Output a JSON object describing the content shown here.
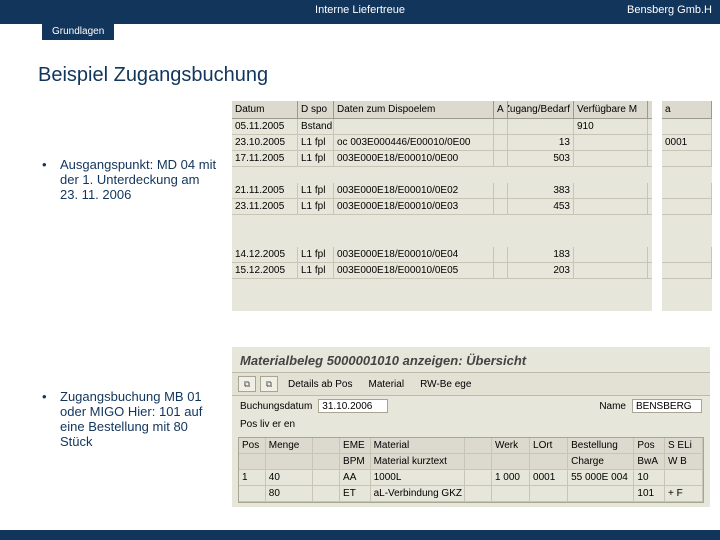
{
  "header": {
    "title_center": "Interne Liefertreue",
    "title_right": "Bensberg Gmb.H",
    "tab": "Grundlagen"
  },
  "heading": "Beispiel Zugangsbuchung",
  "bullets": {
    "b1": "Ausgangspunkt: MD 04 mit der 1. Unterdeckung am 23. 11. 2006",
    "b2": "Zugangsbuchung MB 01 oder MIGO Hier: 101 auf eine Bestellung mit 80 Stück"
  },
  "md04": {
    "headers": {
      "datum": "Datum",
      "dispo": "D spo",
      "elem": "Daten zum Dispoelem",
      "a": "A",
      "zugang": "Zugang/Bedarf",
      "verf": "Verfügbare M"
    },
    "right_header": "a",
    "rows": [
      {
        "datum": "05.11.2005",
        "dispo": "Bstand",
        "elem": "",
        "a": "",
        "zugang": "",
        "verf": "910",
        "right": ""
      },
      {
        "datum": "23.10.2005",
        "dispo": "L1 fpl",
        "elem": "oc 003E000446/E00010/0E00",
        "a": "",
        "zugang": "13",
        "verf": "",
        "right": "0001"
      },
      {
        "datum": "17.11.2005",
        "dispo": "L1 fpl",
        "elem": "003E000E18/E00010/0E00",
        "a": "",
        "zugang": "503",
        "verf": "",
        "right": ""
      },
      {
        "gap": true
      },
      {
        "datum": "21.11.2005",
        "dispo": "L1 fpl",
        "elem": "003E000E18/E00010/0E02",
        "a": "",
        "zugang": "383",
        "verf": "",
        "right": ""
      },
      {
        "datum": "23.11.2005",
        "dispo": "L1 fpl",
        "elem": "003E000E18/E00010/0E03",
        "a": "",
        "zugang": "453",
        "verf": "",
        "right": ""
      },
      {
        "gap": true
      },
      {
        "gap": true
      },
      {
        "datum": "14.12.2005",
        "dispo": "L1 fpl",
        "elem": "003E000E18/E00010/0E04",
        "a": "",
        "zugang": "183",
        "verf": "",
        "right": ""
      },
      {
        "datum": "15.12.2005",
        "dispo": "L1 fpl",
        "elem": "003E000E18/E00010/0E05",
        "a": "",
        "zugang": "203",
        "verf": "",
        "right": ""
      }
    ]
  },
  "beleg": {
    "title": "Materialbeleg 5000001010 anzeigen: Übersicht",
    "toolbar": {
      "b1": "⧉",
      "b2": "⧉",
      "l1": "Details ab Pos",
      "l2": "Material",
      "l3": "RW-Be ege"
    },
    "form": {
      "buchdat_label": "Buchungsdatum",
      "buchdat": "31.10.2006",
      "name_label": "Name",
      "name": "BENSBERG"
    },
    "grid": {
      "headers": [
        "Pos",
        "Menge",
        "",
        "EME",
        "Material",
        "",
        "Werk",
        "LOrt",
        "Bestellung",
        "Pos",
        "S ELi"
      ],
      "sub": [
        "",
        "",
        "",
        "BPM",
        "Material kurztext",
        "",
        "",
        "",
        "Charge",
        "BwA",
        "W B"
      ],
      "rows": [
        [
          "1",
          "40",
          "",
          "AA",
          "1000L",
          "",
          "1 000",
          "0001",
          "55 000E 004",
          "10",
          ""
        ],
        [
          "",
          "80",
          "",
          "ET",
          "aL-Verbindung GKZ",
          "",
          "",
          "",
          "",
          "101",
          "+ F"
        ]
      ]
    },
    "posliv": "Pos liv er en"
  }
}
